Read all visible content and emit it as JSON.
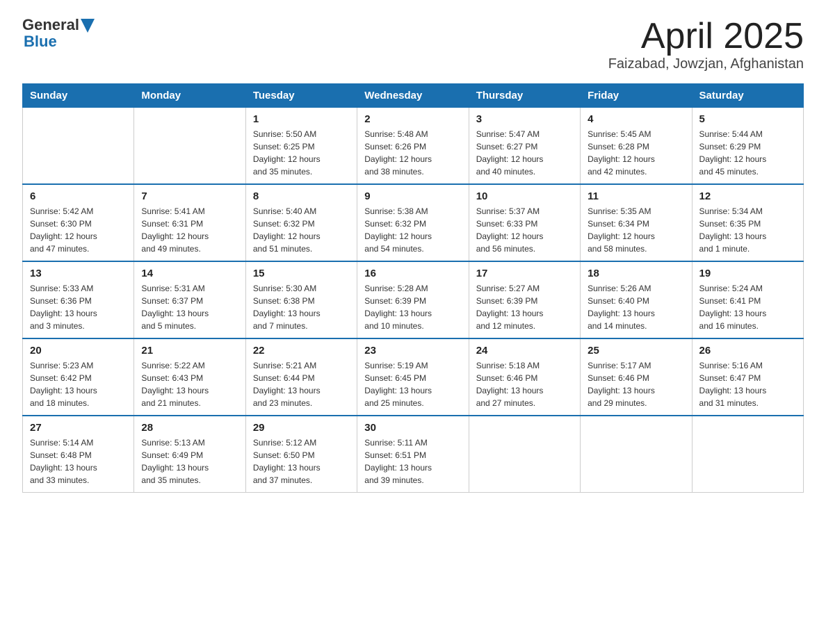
{
  "header": {
    "logo_general": "General",
    "logo_blue": "Blue",
    "title": "April 2025",
    "subtitle": "Faizabad, Jowzjan, Afghanistan"
  },
  "weekdays": [
    "Sunday",
    "Monday",
    "Tuesday",
    "Wednesday",
    "Thursday",
    "Friday",
    "Saturday"
  ],
  "weeks": [
    [
      {
        "day": "",
        "info": ""
      },
      {
        "day": "",
        "info": ""
      },
      {
        "day": "1",
        "info": "Sunrise: 5:50 AM\nSunset: 6:25 PM\nDaylight: 12 hours\nand 35 minutes."
      },
      {
        "day": "2",
        "info": "Sunrise: 5:48 AM\nSunset: 6:26 PM\nDaylight: 12 hours\nand 38 minutes."
      },
      {
        "day": "3",
        "info": "Sunrise: 5:47 AM\nSunset: 6:27 PM\nDaylight: 12 hours\nand 40 minutes."
      },
      {
        "day": "4",
        "info": "Sunrise: 5:45 AM\nSunset: 6:28 PM\nDaylight: 12 hours\nand 42 minutes."
      },
      {
        "day": "5",
        "info": "Sunrise: 5:44 AM\nSunset: 6:29 PM\nDaylight: 12 hours\nand 45 minutes."
      }
    ],
    [
      {
        "day": "6",
        "info": "Sunrise: 5:42 AM\nSunset: 6:30 PM\nDaylight: 12 hours\nand 47 minutes."
      },
      {
        "day": "7",
        "info": "Sunrise: 5:41 AM\nSunset: 6:31 PM\nDaylight: 12 hours\nand 49 minutes."
      },
      {
        "day": "8",
        "info": "Sunrise: 5:40 AM\nSunset: 6:32 PM\nDaylight: 12 hours\nand 51 minutes."
      },
      {
        "day": "9",
        "info": "Sunrise: 5:38 AM\nSunset: 6:32 PM\nDaylight: 12 hours\nand 54 minutes."
      },
      {
        "day": "10",
        "info": "Sunrise: 5:37 AM\nSunset: 6:33 PM\nDaylight: 12 hours\nand 56 minutes."
      },
      {
        "day": "11",
        "info": "Sunrise: 5:35 AM\nSunset: 6:34 PM\nDaylight: 12 hours\nand 58 minutes."
      },
      {
        "day": "12",
        "info": "Sunrise: 5:34 AM\nSunset: 6:35 PM\nDaylight: 13 hours\nand 1 minute."
      }
    ],
    [
      {
        "day": "13",
        "info": "Sunrise: 5:33 AM\nSunset: 6:36 PM\nDaylight: 13 hours\nand 3 minutes."
      },
      {
        "day": "14",
        "info": "Sunrise: 5:31 AM\nSunset: 6:37 PM\nDaylight: 13 hours\nand 5 minutes."
      },
      {
        "day": "15",
        "info": "Sunrise: 5:30 AM\nSunset: 6:38 PM\nDaylight: 13 hours\nand 7 minutes."
      },
      {
        "day": "16",
        "info": "Sunrise: 5:28 AM\nSunset: 6:39 PM\nDaylight: 13 hours\nand 10 minutes."
      },
      {
        "day": "17",
        "info": "Sunrise: 5:27 AM\nSunset: 6:39 PM\nDaylight: 13 hours\nand 12 minutes."
      },
      {
        "day": "18",
        "info": "Sunrise: 5:26 AM\nSunset: 6:40 PM\nDaylight: 13 hours\nand 14 minutes."
      },
      {
        "day": "19",
        "info": "Sunrise: 5:24 AM\nSunset: 6:41 PM\nDaylight: 13 hours\nand 16 minutes."
      }
    ],
    [
      {
        "day": "20",
        "info": "Sunrise: 5:23 AM\nSunset: 6:42 PM\nDaylight: 13 hours\nand 18 minutes."
      },
      {
        "day": "21",
        "info": "Sunrise: 5:22 AM\nSunset: 6:43 PM\nDaylight: 13 hours\nand 21 minutes."
      },
      {
        "day": "22",
        "info": "Sunrise: 5:21 AM\nSunset: 6:44 PM\nDaylight: 13 hours\nand 23 minutes."
      },
      {
        "day": "23",
        "info": "Sunrise: 5:19 AM\nSunset: 6:45 PM\nDaylight: 13 hours\nand 25 minutes."
      },
      {
        "day": "24",
        "info": "Sunrise: 5:18 AM\nSunset: 6:46 PM\nDaylight: 13 hours\nand 27 minutes."
      },
      {
        "day": "25",
        "info": "Sunrise: 5:17 AM\nSunset: 6:46 PM\nDaylight: 13 hours\nand 29 minutes."
      },
      {
        "day": "26",
        "info": "Sunrise: 5:16 AM\nSunset: 6:47 PM\nDaylight: 13 hours\nand 31 minutes."
      }
    ],
    [
      {
        "day": "27",
        "info": "Sunrise: 5:14 AM\nSunset: 6:48 PM\nDaylight: 13 hours\nand 33 minutes."
      },
      {
        "day": "28",
        "info": "Sunrise: 5:13 AM\nSunset: 6:49 PM\nDaylight: 13 hours\nand 35 minutes."
      },
      {
        "day": "29",
        "info": "Sunrise: 5:12 AM\nSunset: 6:50 PM\nDaylight: 13 hours\nand 37 minutes."
      },
      {
        "day": "30",
        "info": "Sunrise: 5:11 AM\nSunset: 6:51 PM\nDaylight: 13 hours\nand 39 minutes."
      },
      {
        "day": "",
        "info": ""
      },
      {
        "day": "",
        "info": ""
      },
      {
        "day": "",
        "info": ""
      }
    ]
  ]
}
